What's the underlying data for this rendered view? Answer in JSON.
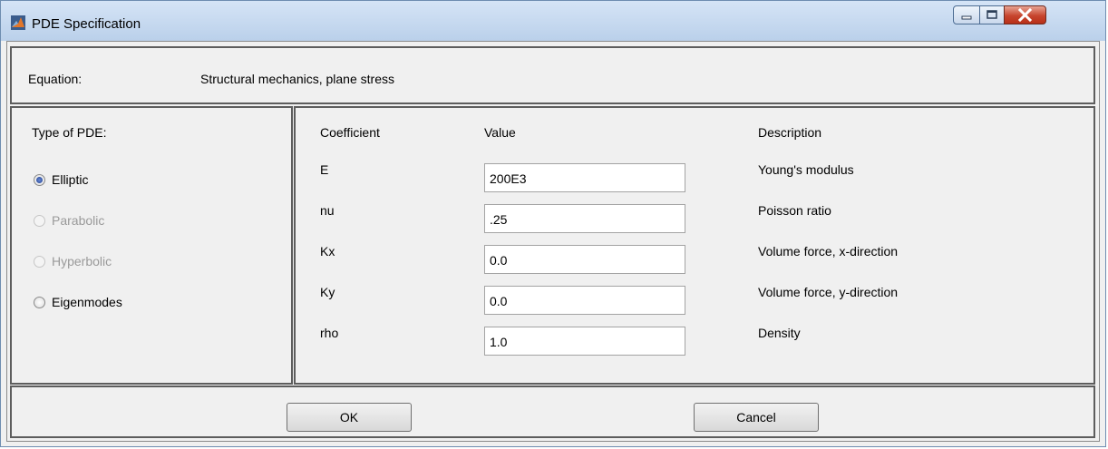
{
  "window": {
    "title": "PDE Specification"
  },
  "equation": {
    "label": "Equation:",
    "value": "Structural mechanics, plane stress"
  },
  "type_panel": {
    "title": "Type of PDE:",
    "options": [
      {
        "label": "Elliptic",
        "selected": true,
        "enabled": true
      },
      {
        "label": "Parabolic",
        "selected": false,
        "enabled": false
      },
      {
        "label": "Hyperbolic",
        "selected": false,
        "enabled": false
      },
      {
        "label": "Eigenmodes",
        "selected": false,
        "enabled": true
      }
    ]
  },
  "coefficients": {
    "headers": {
      "coefficient": "Coefficient",
      "value": "Value",
      "description": "Description"
    },
    "rows": [
      {
        "name": "E",
        "value": "200E3",
        "description": "Young's modulus"
      },
      {
        "name": "nu",
        "value": ".25",
        "description": "Poisson ratio"
      },
      {
        "name": "Kx",
        "value": "0.0",
        "description": "Volume force, x-direction"
      },
      {
        "name": "Ky",
        "value": "0.0",
        "description": "Volume force, y-direction"
      },
      {
        "name": "rho",
        "value": "1.0",
        "description": "Density"
      }
    ]
  },
  "buttons": {
    "ok": "OK",
    "cancel": "Cancel"
  }
}
